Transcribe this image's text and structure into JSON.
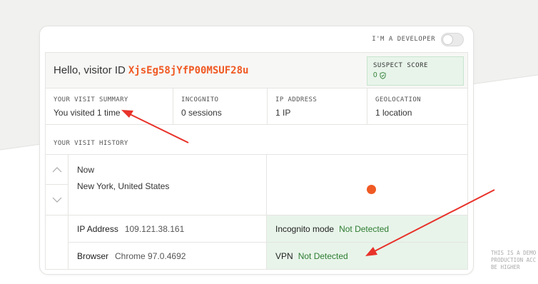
{
  "developer_toggle": {
    "label": "I'M A DEVELOPER",
    "state": "off"
  },
  "greeting": {
    "prefix": "Hello, visitor ID",
    "visitor_id": "XjsEg58jYfP00MSUF28u"
  },
  "suspect_score": {
    "label": "SUSPECT SCORE",
    "value": "0",
    "icon": "shield-check-icon"
  },
  "summary": [
    {
      "label": "YOUR VISIT SUMMARY",
      "value": "You visited 1 time"
    },
    {
      "label": "INCOGNITO",
      "value": "0 sessions"
    },
    {
      "label": "IP ADDRESS",
      "value": "1 IP"
    },
    {
      "label": "GEOLOCATION",
      "value": "1 location"
    }
  ],
  "history": {
    "label": "YOUR VISIT HISTORY",
    "time": "Now",
    "location": "New York, United States",
    "ip": {
      "key": "IP Address",
      "value": "109.121.38.161"
    },
    "browser": {
      "key": "Browser",
      "value": "Chrome 97.0.4692"
    },
    "incognito": {
      "key": "Incognito mode",
      "value": "Not Detected"
    },
    "vpn": {
      "key": "VPN",
      "value": "Not Detected"
    }
  },
  "demo_note": [
    "THIS IS A DEMO",
    "PRODUCTION ACC",
    "BE HIGHER"
  ],
  "colors": {
    "accent": "#f05a24",
    "ok_green": "#2e7d32",
    "ok_bg": "#e8f4ea",
    "annotation_red": "#e8322a"
  }
}
